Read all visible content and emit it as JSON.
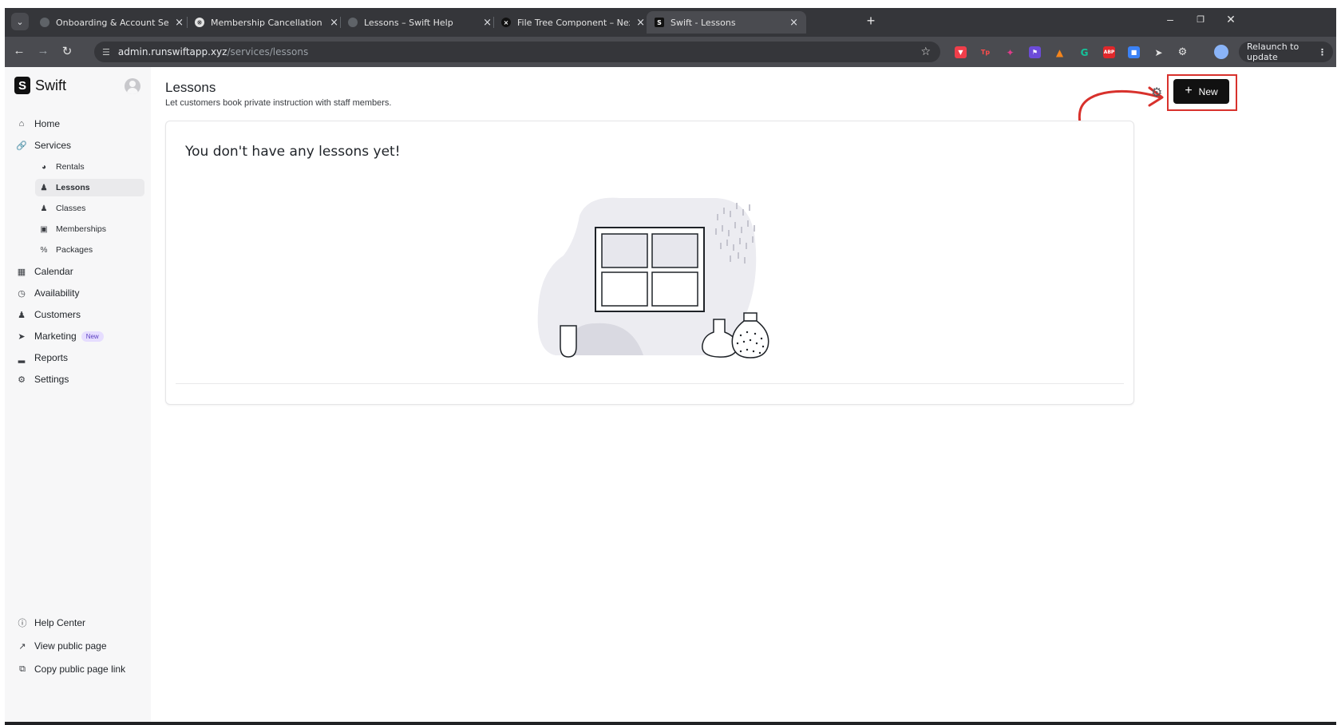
{
  "browser": {
    "tabs": [
      {
        "title": "Onboarding & Account Setup -",
        "active": false
      },
      {
        "title": "Membership Cancellation Instru",
        "active": false
      },
      {
        "title": "Lessons – Swift Help",
        "active": false
      },
      {
        "title": "File Tree Component – Nextra",
        "active": false
      },
      {
        "title": "Swift - Lessons",
        "active": true
      }
    ],
    "url_host": "admin.runswiftapp.xyz",
    "url_path": "/services/lessons",
    "relaunch_label": "Relaunch to update",
    "extension_badges": [
      "Tp",
      "ABP",
      "G"
    ]
  },
  "sidebar": {
    "app_name": "Swift",
    "logo_letter": "S",
    "nav": {
      "home": "Home",
      "services": "Services",
      "rentals": "Rentals",
      "lessons": "Lessons",
      "classes": "Classes",
      "memberships": "Memberships",
      "packages": "Packages",
      "calendar": "Calendar",
      "availability": "Availability",
      "customers": "Customers",
      "marketing": "Marketing",
      "marketing_badge": "New",
      "reports": "Reports",
      "settings": "Settings"
    },
    "footer": {
      "help_center": "Help Center",
      "view_public_page": "View public page",
      "copy_public_page_link": "Copy public page link"
    }
  },
  "main": {
    "title": "Lessons",
    "subtitle": "Let customers book private instruction with staff members.",
    "new_button_label": "New",
    "empty_state_title": "You don't have any lessons yet!"
  },
  "colors": {
    "accent": "#111111",
    "annotation_red": "#d8312c",
    "sidebar_bg": "#f7f7f8",
    "badge_purple": "#e6ddff"
  }
}
